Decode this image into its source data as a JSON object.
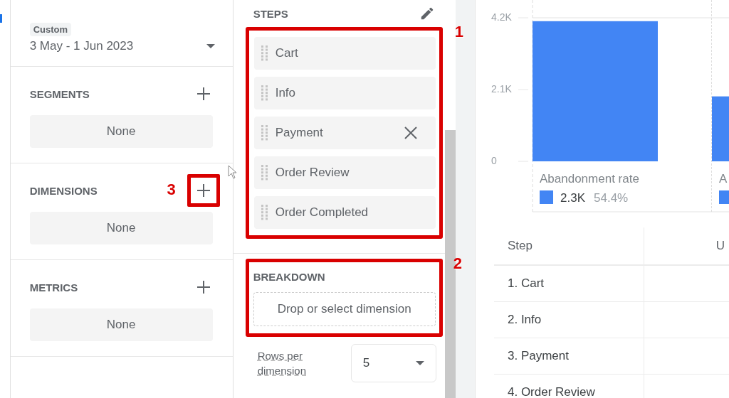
{
  "date_range": {
    "chip": "Custom",
    "value": "3 May - 1 Jun 2023"
  },
  "variables": [
    {
      "title": "SEGMENTS",
      "value": "None"
    },
    {
      "title": "DIMENSIONS",
      "value": "None",
      "callout": "3"
    },
    {
      "title": "METRICS",
      "value": "None"
    }
  ],
  "steps": {
    "title": "STEPS",
    "callout": "1",
    "items": [
      {
        "label": "Cart",
        "removable": false
      },
      {
        "label": "Info",
        "removable": false
      },
      {
        "label": "Payment",
        "removable": true
      },
      {
        "label": "Order Review",
        "removable": false
      },
      {
        "label": "Order Completed",
        "removable": false
      }
    ]
  },
  "breakdown": {
    "title": "BREAKDOWN",
    "callout": "2",
    "placeholder": "Drop or select dimension"
  },
  "rows_per_dimension": {
    "label": "Rows per dimension",
    "value": "5"
  },
  "chart": {
    "chart_data": {
      "type": "bar",
      "categories": [
        "Abandonment rate",
        "A"
      ],
      "series": [
        {
          "color": "#4285f4",
          "values": [
            4100,
            1900
          ]
        }
      ],
      "ylim": [
        0,
        4200
      ],
      "yticks": [
        {
          "value": 0,
          "label": "0"
        },
        {
          "value": 2100,
          "label": "2.1K"
        },
        {
          "value": 4200,
          "label": "4.2K"
        }
      ]
    },
    "bar_legends": [
      {
        "value": "2.3K",
        "share": "54.4%"
      }
    ]
  },
  "table": {
    "columns": [
      "Step",
      "U"
    ],
    "rows": [
      [
        "1. Cart"
      ],
      [
        "2. Info"
      ],
      [
        "3. Payment"
      ],
      [
        "4. Order Review"
      ]
    ]
  }
}
